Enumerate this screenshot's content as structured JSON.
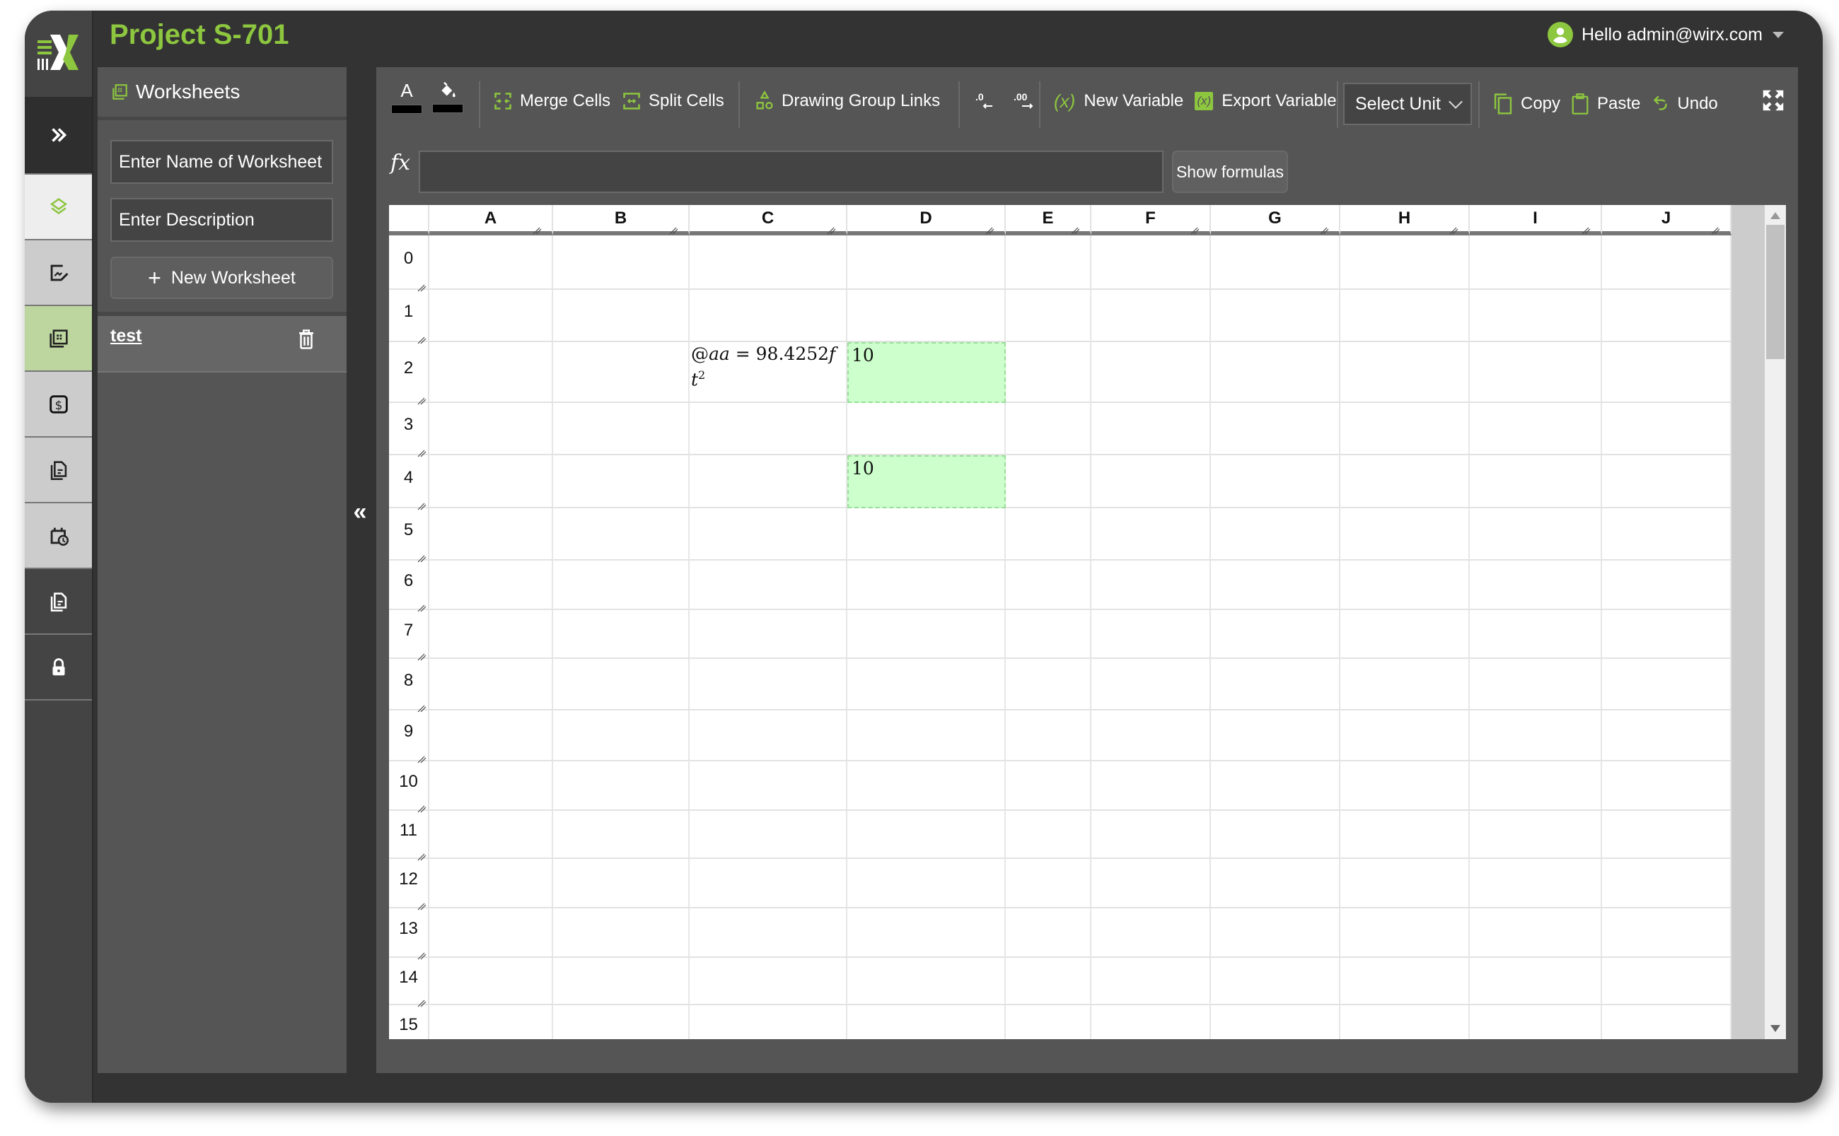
{
  "header": {
    "title": "Project S-701",
    "user_greeting": "Hello admin@wirx.com"
  },
  "rail": {
    "items": [
      {
        "icon": "chevrons-right-icon",
        "state": "dark"
      },
      {
        "icon": "layers-icon",
        "state": "white"
      },
      {
        "icon": "edit-chart-icon",
        "state": "light"
      },
      {
        "icon": "worksheet-icon",
        "state": "active"
      },
      {
        "icon": "dollar-icon",
        "state": "light"
      },
      {
        "icon": "documents-icon",
        "state": "light"
      },
      {
        "icon": "calendar-clock-icon",
        "state": "light"
      },
      {
        "icon": "report-icon",
        "state": "dark"
      },
      {
        "icon": "lock-icon",
        "state": "dark"
      }
    ]
  },
  "worksheets": {
    "heading": "Worksheets",
    "name_placeholder": "Enter Name of Worksheet",
    "description_placeholder": "Enter Description",
    "new_button": "New Worksheet",
    "items": [
      {
        "name": "test"
      }
    ]
  },
  "toolbar": {
    "font_color_label": "A",
    "font_color": "#000000",
    "fill_color": "#000000",
    "merge_cells": "Merge Cells",
    "split_cells": "Split Cells",
    "drawing_group_links": "Drawing Group Links",
    "decrease_decimal": ".0",
    "increase_decimal": ".00",
    "new_variable": "New Variable",
    "export_variable": "Export Variable",
    "select_unit": "Select Unit",
    "copy": "Copy",
    "paste": "Paste",
    "undo": "Undo"
  },
  "formula_bar": {
    "fx_label": "fx",
    "value": "",
    "show_formulas": "Show formulas"
  },
  "sheet": {
    "columns": [
      "A",
      "B",
      "C",
      "D",
      "E",
      "F",
      "G",
      "H",
      "I",
      "J"
    ],
    "rows": [
      "0",
      "1",
      "2",
      "3",
      "4",
      "5",
      "6",
      "7",
      "8",
      "9",
      "10",
      "11",
      "12",
      "13",
      "14",
      "15"
    ],
    "cells": {
      "C2": {
        "line1_prefix": "@",
        "line1_var": "aa",
        "line1_eq": " = 98.4252",
        "line1_unit": "f",
        "line2_base": "t",
        "line2_exp": "2"
      },
      "D2": {
        "value": "10",
        "highlight": true
      },
      "D4": {
        "value": "10",
        "highlight": true
      }
    },
    "highlight_color": "#ccffcc"
  },
  "colors": {
    "accent": "#8dc63f",
    "frame": "#333333",
    "panel": "#555555"
  }
}
